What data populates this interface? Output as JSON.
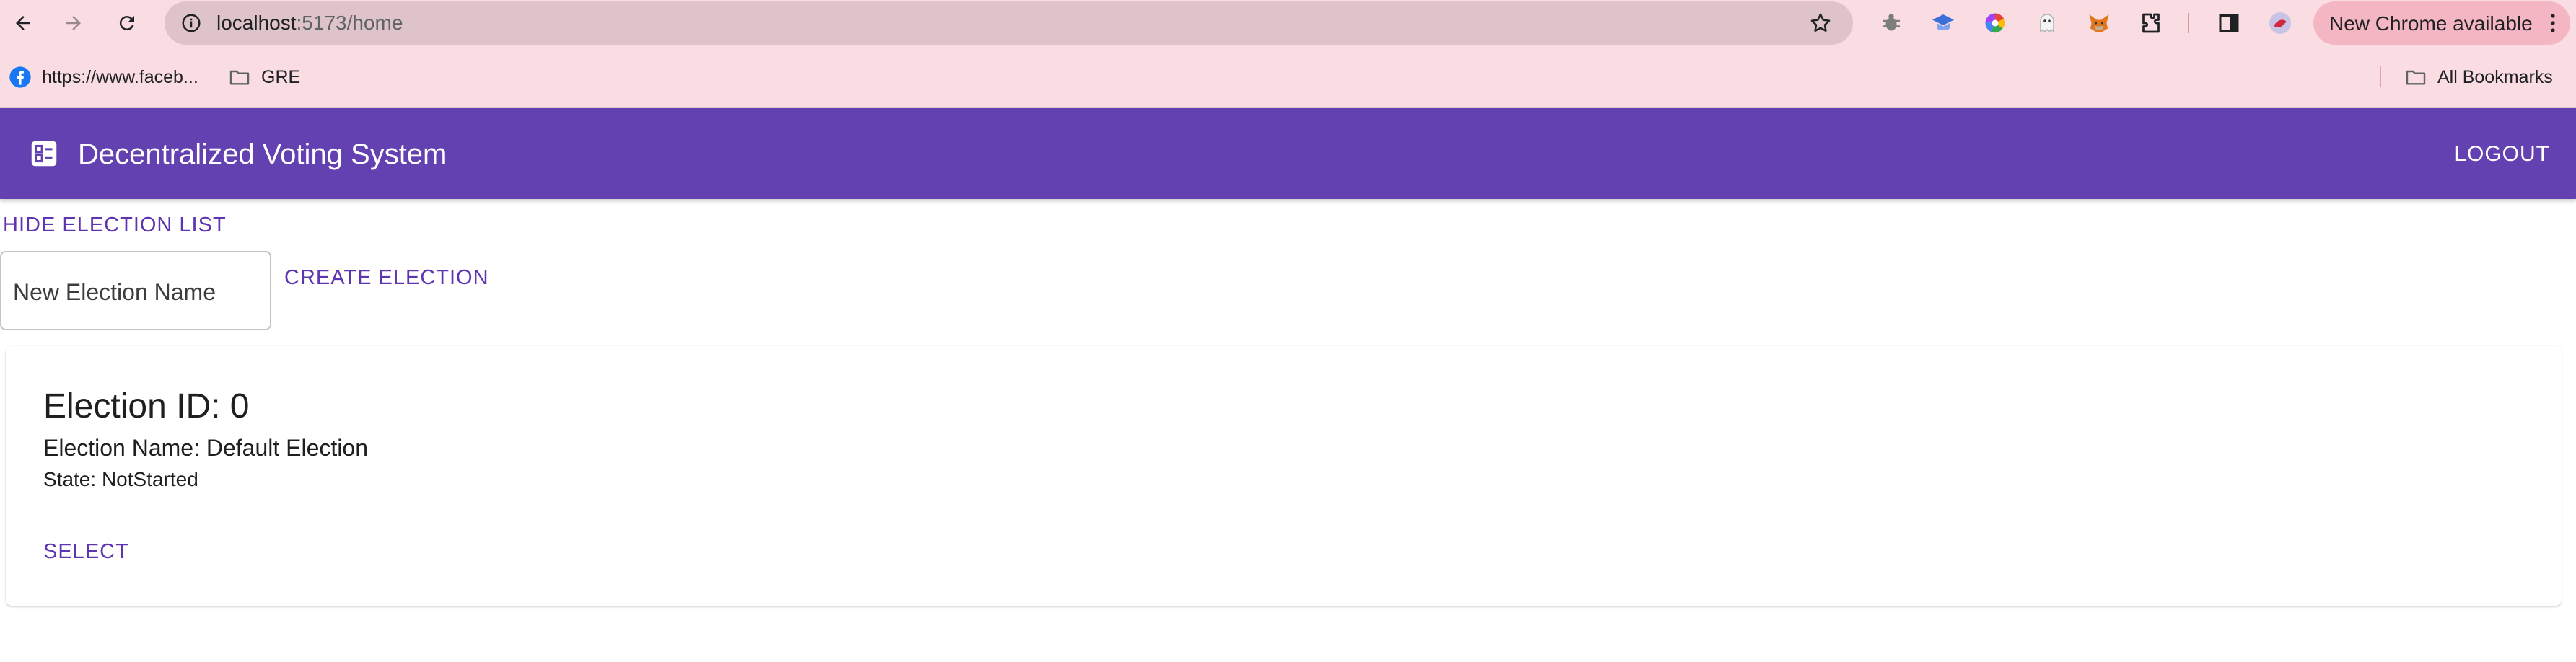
{
  "browser": {
    "url_host": "localhost",
    "url_path": ":5173/home",
    "update_label": "New Chrome available",
    "bookmarks": [
      {
        "label": "https://www.faceb...",
        "icon": "facebook-icon"
      },
      {
        "label": "GRE",
        "icon": "folder-icon"
      }
    ],
    "all_bookmarks_label": "All Bookmarks",
    "extensions": [
      "bug-extension-icon",
      "graduation-cap-extension-icon",
      "color-wheel-extension-icon",
      "ghost-extension-icon",
      "metamask-fox-icon",
      "puzzle-extensions-icon"
    ]
  },
  "app": {
    "title": "Decentralized Voting System",
    "logout_label": "LOGOUT",
    "bar_color": "#6441b0",
    "accent_color": "#5e35b1"
  },
  "main": {
    "hide_list_label": "HIDE ELECTION LIST",
    "new_election_placeholder": "New Election Name",
    "new_election_value": "",
    "create_label": "CREATE ELECTION",
    "elections": [
      {
        "id_line": "Election ID: 0",
        "name_line": "Election Name: Default Election",
        "state_line": "State: NotStarted",
        "select_label": "SELECT"
      }
    ]
  }
}
